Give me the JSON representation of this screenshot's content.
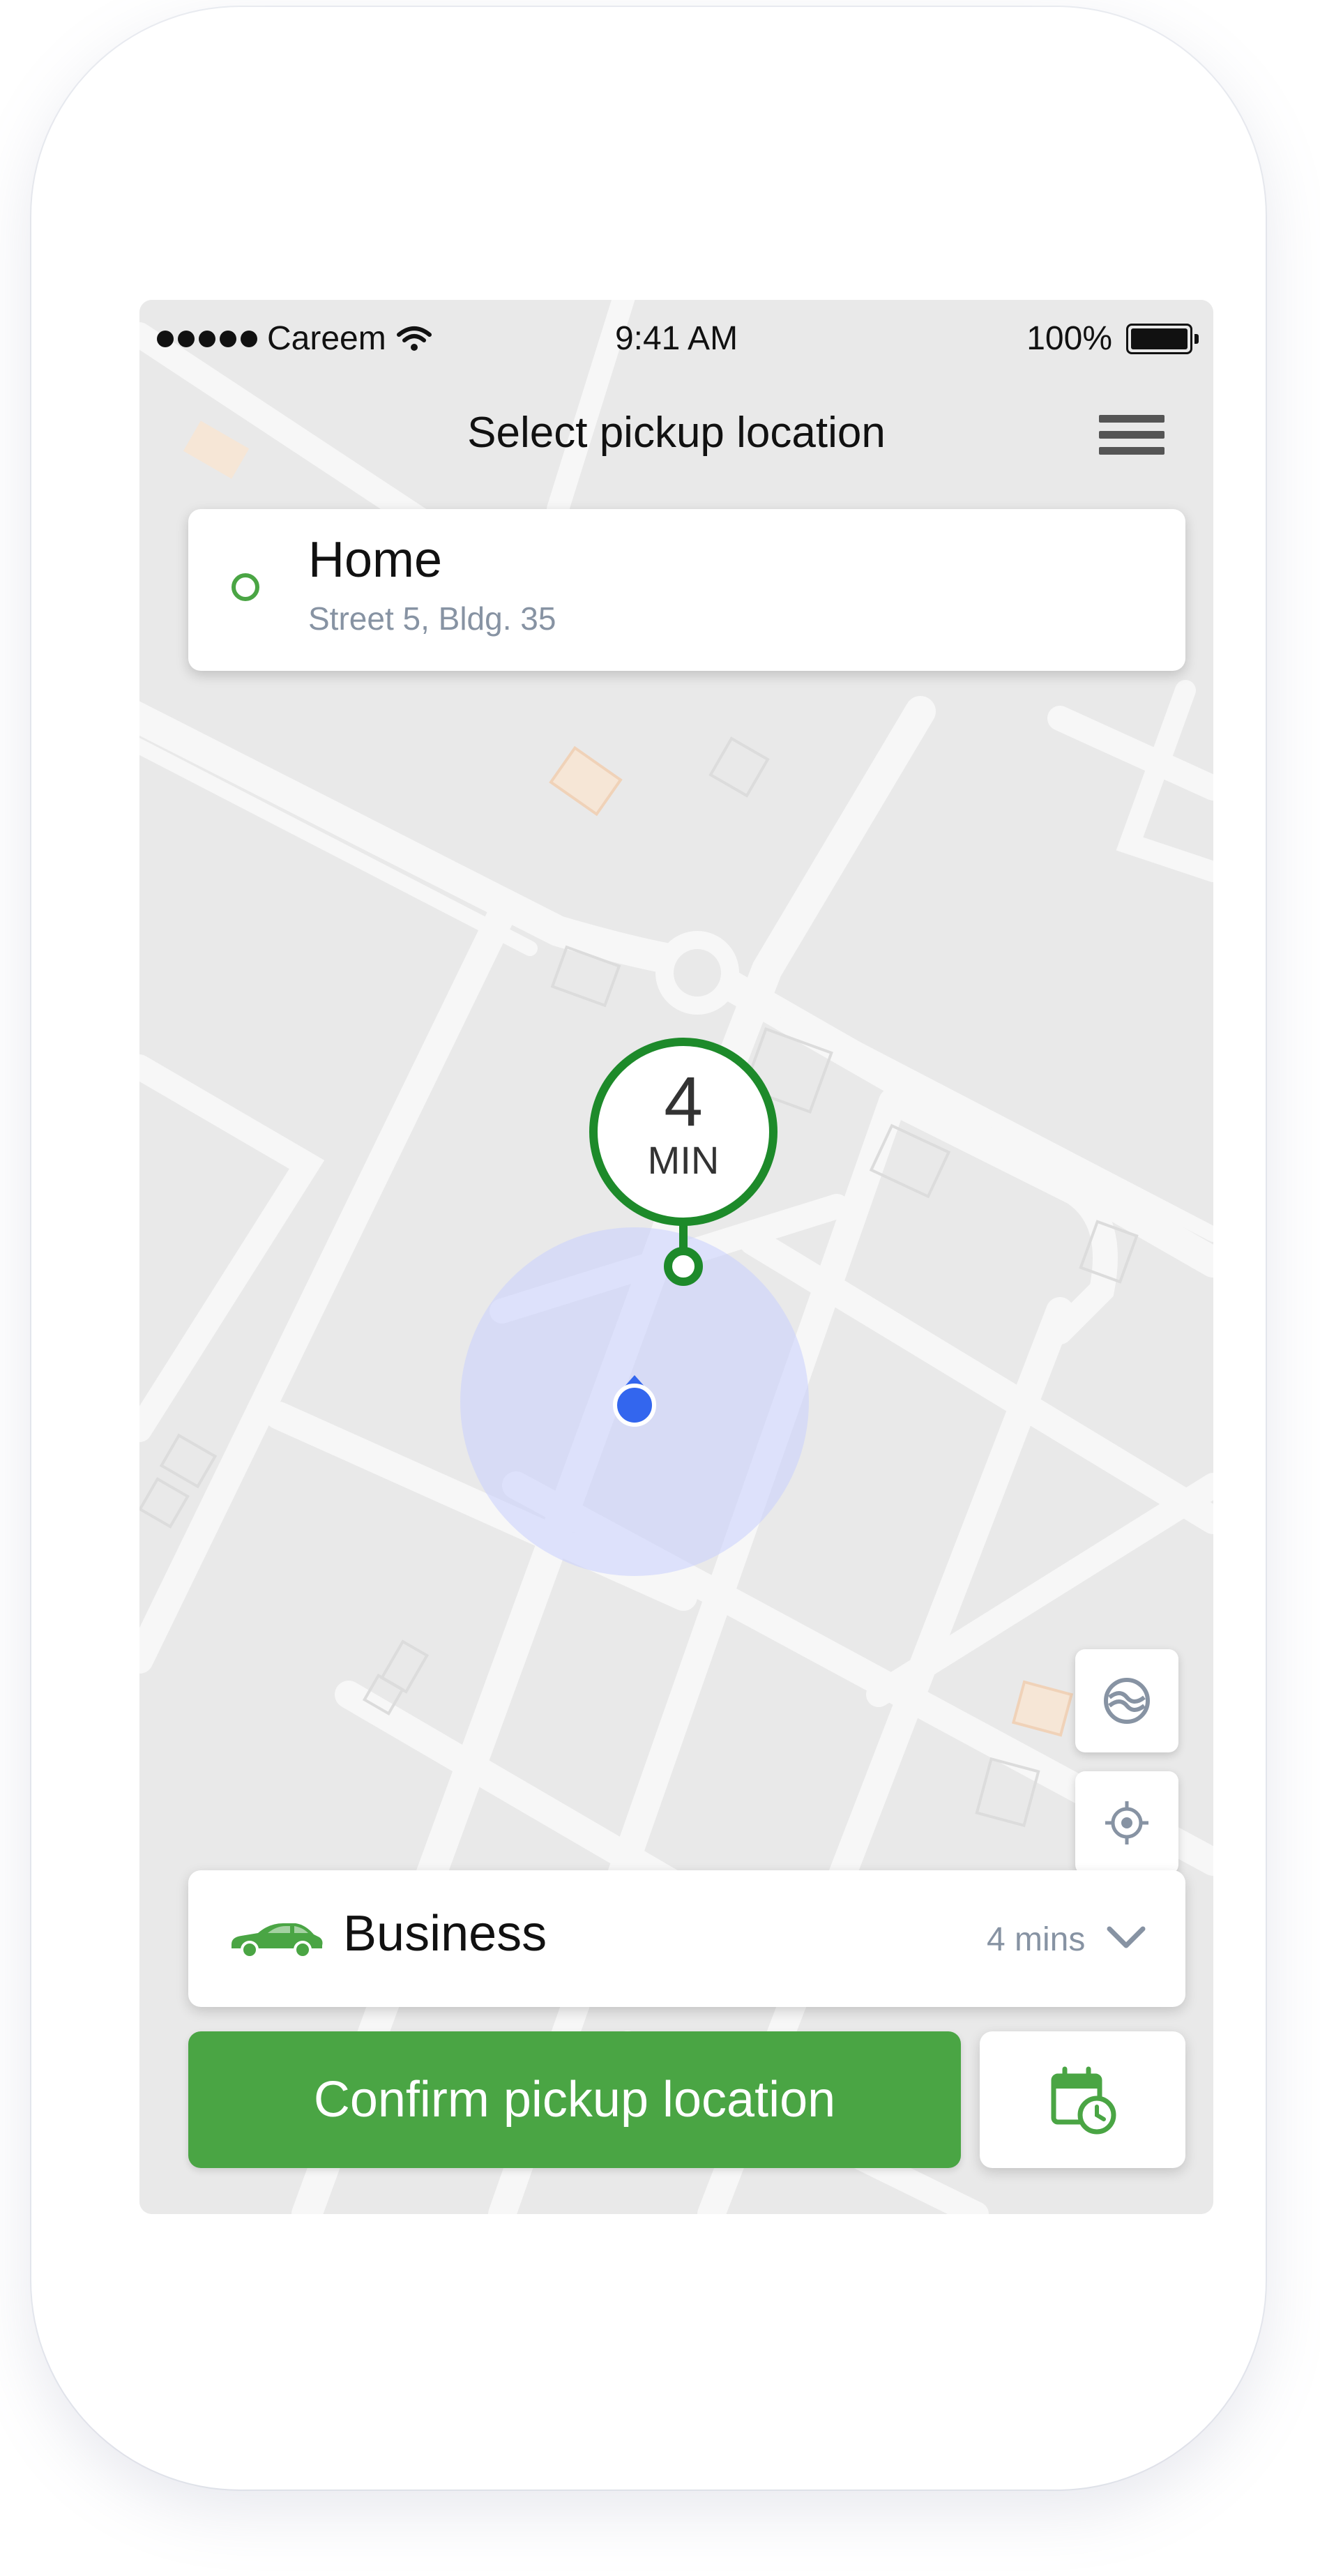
{
  "status_bar": {
    "carrier": "Careem",
    "time": "9:41 AM",
    "battery": "100%"
  },
  "header": {
    "title": "Select pickup location"
  },
  "pickup": {
    "title": "Home",
    "address": "Street 5, Bldg. 35"
  },
  "eta_pin": {
    "value": "4",
    "unit": "MIN"
  },
  "vehicle": {
    "name": "Business",
    "eta": "4 mins"
  },
  "actions": {
    "confirm_label": "Confirm pickup location"
  },
  "icons": {
    "menu": "hamburger-menu-icon",
    "pickup_marker": "pickup-ring-icon",
    "map_layers": "map-style-icon",
    "locate": "locate-me-icon",
    "car": "car-icon",
    "chevron": "chevron-down-icon",
    "schedule": "calendar-clock-icon"
  },
  "colors": {
    "brand_green": "#4aa544",
    "pin_green": "#1d8a2a",
    "user_blue": "#3366ee",
    "muted_text": "#8793a3"
  }
}
